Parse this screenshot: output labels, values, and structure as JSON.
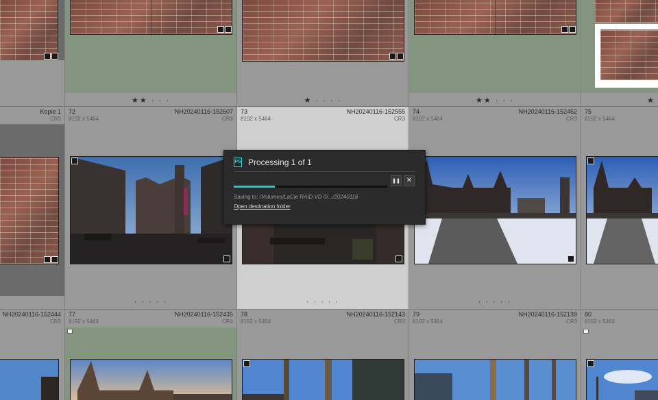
{
  "top_row": [
    {
      "stars": ""
    },
    {
      "stars": "★★ · · ·"
    },
    {
      "stars": "★ · · · ·"
    },
    {
      "stars": "★★ · · ·"
    },
    {
      "stars": "★"
    }
  ],
  "mid_row": [
    {
      "number": "",
      "filename": "Kopie 1",
      "dims": "",
      "ext": "CR3",
      "stars": ""
    },
    {
      "number": "72",
      "filename": "NH20240116-152607",
      "dims": "8192 x 5464",
      "ext": "CR3",
      "stars": "· · · · ·"
    },
    {
      "number": "73",
      "filename": "NH20240116-152555",
      "dims": "8192 x 5464",
      "ext": "CR3",
      "stars": "· · · · ·"
    },
    {
      "number": "74",
      "filename": "NH20240116-152452",
      "dims": "8192 x 5464",
      "ext": "CR3",
      "stars": "· · · · ·"
    },
    {
      "number": "75",
      "filename": "",
      "dims": "8192 x 5464",
      "ext": "",
      "stars": ""
    }
  ],
  "bottom_row": [
    {
      "number": "",
      "filename": "NH20240116-152444",
      "dims": "",
      "ext": "CR3"
    },
    {
      "number": "77",
      "filename": "NH20240116-152435",
      "dims": "8192 x 5464",
      "ext": "CR3"
    },
    {
      "number": "78",
      "filename": "NH20240116-152143",
      "dims": "8192 x 5464",
      "ext": "CR3"
    },
    {
      "number": "79",
      "filename": "NH20240116-152139",
      "dims": "8192 x 5464",
      "ext": "CR3"
    },
    {
      "number": "80",
      "filename": "",
      "dims": "8192 x 5464",
      "ext": ""
    }
  ],
  "dialog": {
    "title": "Processing 1 of 1",
    "progress": 0.27,
    "pause_icon": "pause-icon",
    "close_icon": "close-icon",
    "pause_glyph": "❚❚",
    "close_glyph": "✕",
    "saving_prefix": "Saving to: ",
    "saving_path": "/Volumes/LaCie RAID VD 0/.../20240116",
    "open_link": "Open destination folder",
    "app_icon_label": "PS"
  },
  "colors": {
    "accent": "#1fc9d3",
    "cell_bg": "#999999",
    "cell_green": "#84957f",
    "cell_selected": "#cfcfcf",
    "dialog_bg": "#2b2b2b"
  }
}
